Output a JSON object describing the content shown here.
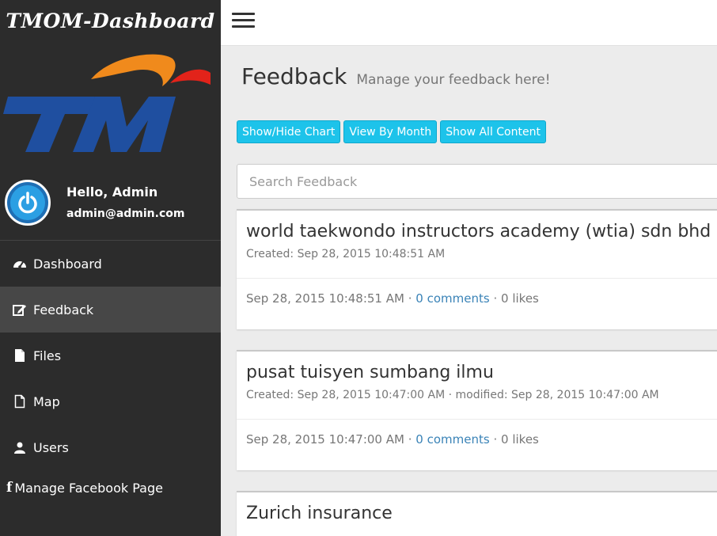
{
  "sidebar": {
    "brand": "TMOM-Dashboard",
    "logo_text": "TM",
    "greeting": "Hello, Admin",
    "email": "admin@admin.com",
    "nav": [
      {
        "label": "Dashboard",
        "icon": "dashboard-icon"
      },
      {
        "label": "Feedback",
        "icon": "edit-icon",
        "active": true
      },
      {
        "label": "Files",
        "icon": "file-icon"
      },
      {
        "label": "Map",
        "icon": "file-outline-icon"
      },
      {
        "label": "Users",
        "icon": "user-icon"
      }
    ],
    "facebook": {
      "icon": "f",
      "label": "Manage Facebook Page"
    }
  },
  "page": {
    "title": "Feedback",
    "subtitle": "Manage your feedback here!"
  },
  "buttons": {
    "toggle_chart": "Show/Hide Chart",
    "by_month": "View By Month",
    "all_content": "Show All Content"
  },
  "search": {
    "placeholder": "Search Feedback"
  },
  "feed": [
    {
      "title": "world taekwondo instructors academy (wtia) sdn bhd",
      "meta": "Created: Sep 28, 2015 10:48:51 AM",
      "date": "Sep 28, 2015 10:48:51 AM",
      "comments": "0 comments",
      "likes": "0 likes"
    },
    {
      "title": "pusat tuisyen sumbang ilmu",
      "meta": "Created: Sep 28, 2015 10:47:00 AM · modified: Sep 28, 2015 10:47:00 AM",
      "date": "Sep 28, 2015 10:47:00 AM",
      "comments": "0 comments",
      "likes": "0 likes"
    },
    {
      "title": "Zurich insurance"
    }
  ],
  "colors": {
    "sidebar_bg": "#2c2c2c",
    "active_bg": "#474747",
    "button": "#1dc3ea",
    "link": "#3a83b7",
    "logo_blue": "#1f4fa0",
    "logo_orange": "#f08a1c",
    "logo_red": "#e2231a"
  }
}
